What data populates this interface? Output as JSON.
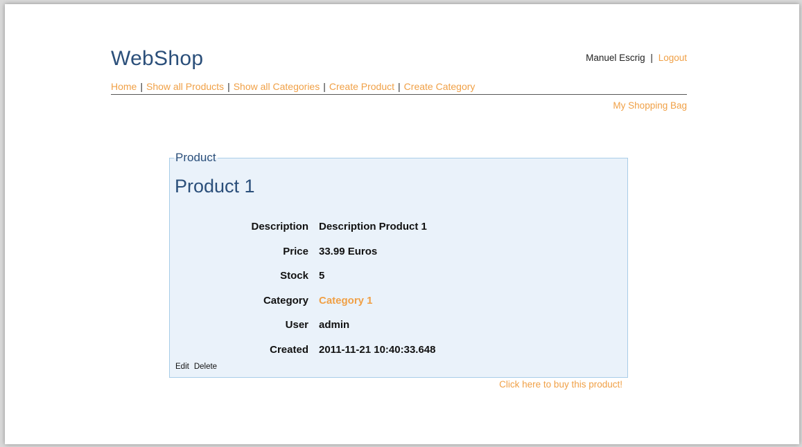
{
  "header": {
    "logo": "WebShop",
    "user_name": "Manuel Escrig",
    "separator": "|",
    "logout_label": "Logout",
    "my_bag_label": "My Shopping Bag"
  },
  "nav": {
    "items": [
      {
        "label": "Home"
      },
      {
        "label": "Show all Products"
      },
      {
        "label": "Show all Categories"
      },
      {
        "label": "Create Product"
      },
      {
        "label": "Create Category"
      }
    ],
    "separator": "|"
  },
  "product": {
    "legend": "Product",
    "title": "Product 1",
    "fields": {
      "description": {
        "label": "Description",
        "value": "Description Product 1"
      },
      "price": {
        "label": "Price",
        "value": "33.99 Euros"
      },
      "stock": {
        "label": "Stock",
        "value": "5"
      },
      "category": {
        "label": "Category",
        "value": "Category 1"
      },
      "user": {
        "label": "User",
        "value": "admin"
      },
      "created": {
        "label": "Created",
        "value": "2011-11-21 10:40:33.648"
      }
    },
    "edit_label": "Edit",
    "delete_label": "Delete",
    "buy_label": "Click here to buy this product!"
  },
  "colors": {
    "link": "#f0a046",
    "brand": "#2b4f7a",
    "panel_bg": "#eaf2fa",
    "panel_border": "#a8cde8"
  }
}
